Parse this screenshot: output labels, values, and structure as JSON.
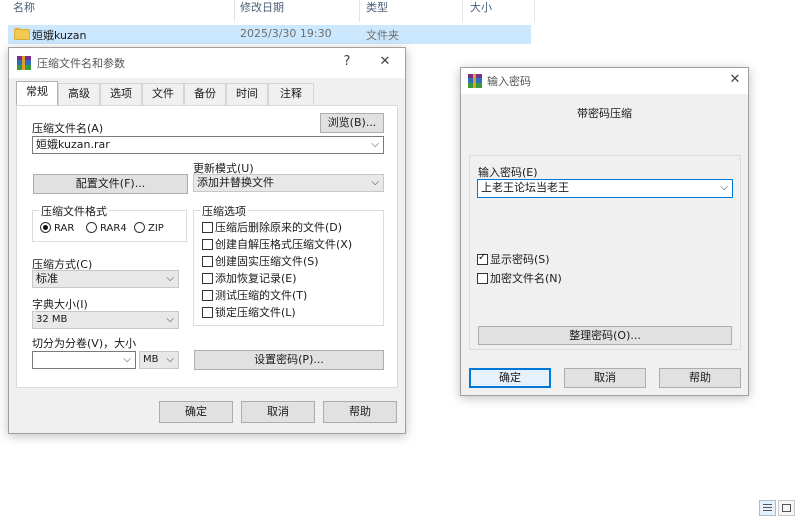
{
  "explorer": {
    "columns": {
      "name": "名称",
      "modified": "修改日期",
      "type": "类型",
      "size": "大小"
    },
    "row": {
      "name": "姮娥kuzan",
      "modified": "2025/3/30 19:30",
      "type": "文件夹",
      "icon": "folder-icon"
    }
  },
  "archive_dialog": {
    "title": "压缩文件名和参数",
    "help_glyph": "?",
    "close_glyph": "✕",
    "tabs": [
      "常规",
      "高级",
      "选项",
      "文件",
      "备份",
      "时间",
      "注释"
    ],
    "active_tab": "常规",
    "archive_name_label": "压缩文件名(A)",
    "browse_button": "浏览(B)...",
    "archive_name_value": "姮娥kuzan.rar",
    "update_mode_label": "更新模式(U)",
    "update_mode_value": "添加并替换文件",
    "profiles_button": "配置文件(F)...",
    "format_group": {
      "title": "压缩文件格式",
      "options": [
        "RAR",
        "RAR4",
        "ZIP"
      ],
      "selected": "RAR"
    },
    "options_group": {
      "title": "压缩选项",
      "items": [
        {
          "label": "压缩后删除原来的文件(D)",
          "checked": false
        },
        {
          "label": "创建自解压格式压缩文件(X)",
          "checked": false
        },
        {
          "label": "创建固实压缩文件(S)",
          "checked": false
        },
        {
          "label": "添加恢复记录(E)",
          "checked": false
        },
        {
          "label": "测试压缩的文件(T)",
          "checked": false
        },
        {
          "label": "锁定压缩文件(L)",
          "checked": false
        }
      ]
    },
    "method_label": "压缩方式(C)",
    "method_value": "标准",
    "dict_label": "字典大小(I)",
    "dict_value": "32 MB",
    "split_label": "切分为分卷(V)，大小",
    "split_value": "",
    "split_unit": "MB",
    "set_password_button": "设置密码(P)...",
    "ok_button": "确定",
    "cancel_button": "取消",
    "help_button": "帮助"
  },
  "password_dialog": {
    "title": "输入密码",
    "close_glyph": "✕",
    "heading": "带密码压缩",
    "password_label": "输入密码(E)",
    "password_value": "上老王论坛当老王",
    "show_password": {
      "label": "显示密码(S)",
      "checked": true
    },
    "encrypt_names": {
      "label": "加密文件名(N)",
      "checked": false
    },
    "organize_button": "整理密码(O)...",
    "ok_button": "确定",
    "cancel_button": "取消",
    "help_button": "帮助"
  },
  "colors": {
    "selection": "#cce8ff",
    "dialog_bg": "#f0f0f0",
    "focus_blue": "#0078d7"
  }
}
